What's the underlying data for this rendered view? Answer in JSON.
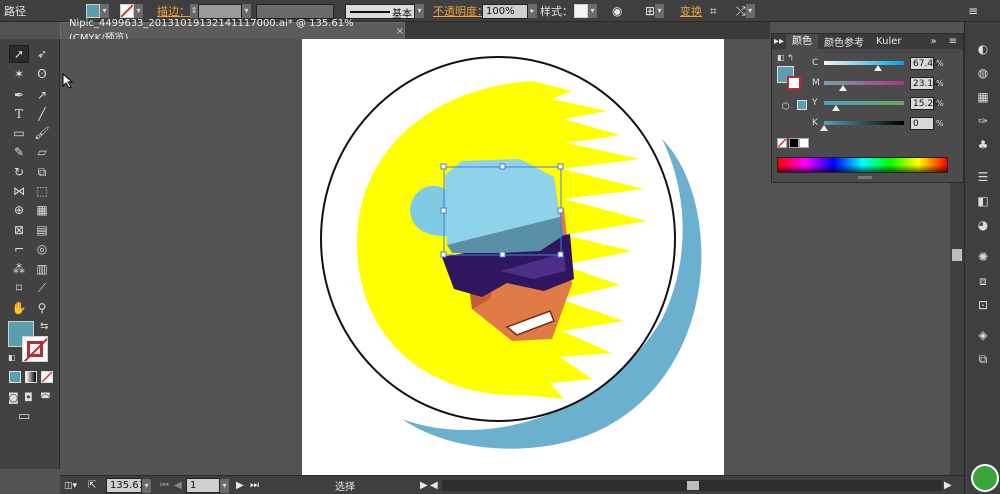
{
  "control_bar": {
    "selection_type": "路径",
    "stroke_label": "描边：",
    "stroke_profile": "基本",
    "opacity_label": "不透明度：",
    "opacity_value": "100%",
    "style_label": "样式：",
    "transform_label": "变换",
    "fill_color": "#5b9eb0"
  },
  "document_tab": {
    "title": "Nipic_4499633_20131019132141117000.ai* @ 135.61% (CMYK/预览)",
    "close": "×"
  },
  "color_panel": {
    "tabs": [
      "颜色",
      "颜色参考",
      "Kuler"
    ],
    "fill_color": "#5b9eb0",
    "channels": [
      {
        "name": "C",
        "value": "67.45",
        "fraction": 0.6745
      },
      {
        "name": "M",
        "value": "23.14",
        "fraction": 0.2314
      },
      {
        "name": "Y",
        "value": "15.29",
        "fraction": 0.1529
      },
      {
        "name": "K",
        "value": "0",
        "fraction": 0
      }
    ],
    "unit": "%"
  },
  "status_bar": {
    "zoom": "135.61",
    "page": "1",
    "tool_status": "选择"
  },
  "colors": {
    "sun": "#ffff00",
    "cap": "#7fcbe3",
    "visor": "#5a8fa8",
    "glasses": "#2e1660",
    "skin": "#e07a46",
    "shadow_ring": "#6bb0cf"
  }
}
